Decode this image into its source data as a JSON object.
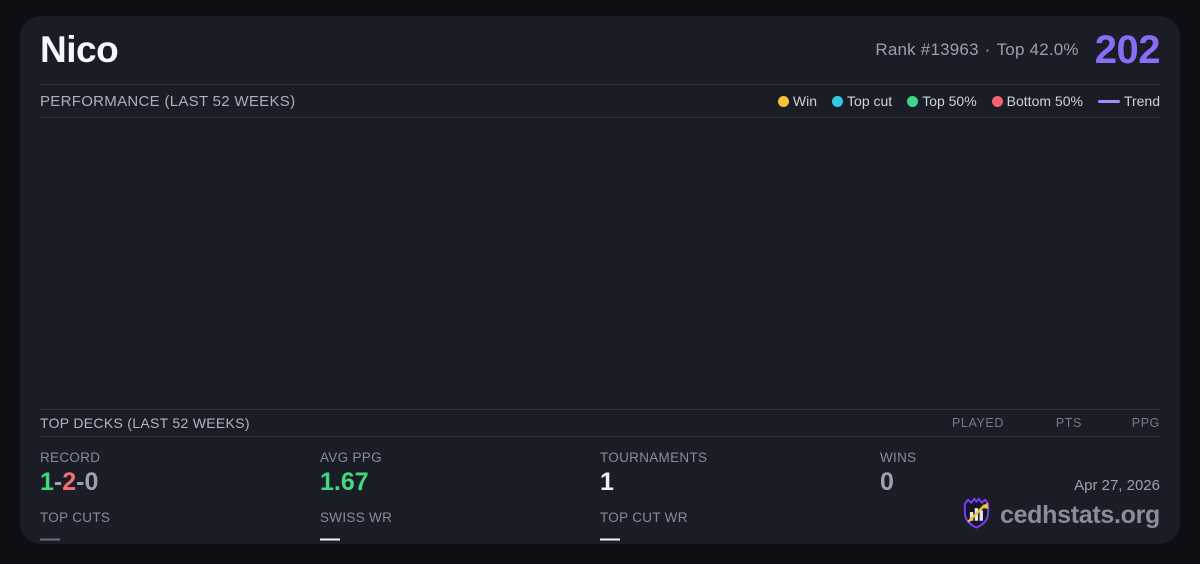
{
  "card": {
    "title": "Nico",
    "rank_text": "Rank #13963",
    "separator": "·",
    "top_percent_text": "Top 42.0%",
    "points": "202",
    "accent_color": "#8b6cf5"
  },
  "performance": {
    "header": "PERFORMANCE (LAST 52 WEEKS)",
    "legend": [
      {
        "label": "Win",
        "color": "#f5c33b",
        "marker": "dot"
      },
      {
        "label": "Top cut",
        "color": "#35c9e3",
        "marker": "dot"
      },
      {
        "label": "Top 50%",
        "color": "#3fd68a",
        "marker": "dot"
      },
      {
        "label": "Bottom 50%",
        "color": "#f4646e",
        "marker": "dot"
      },
      {
        "label": "Trend",
        "color": "#a78bfa",
        "marker": "line"
      }
    ]
  },
  "chart_data": {
    "type": "scatter",
    "title": "PERFORMANCE (LAST 52 WEEKS)",
    "series": [
      {
        "name": "Win",
        "points": []
      },
      {
        "name": "Top cut",
        "points": []
      },
      {
        "name": "Top 50%",
        "points": []
      },
      {
        "name": "Bottom 50%",
        "points": []
      },
      {
        "name": "Trend",
        "points": []
      }
    ],
    "note_visible_points": "chart area is empty in the visible window"
  },
  "top_decks": {
    "header": "TOP DECKS (LAST 52 WEEKS)",
    "columns": [
      "PLAYED",
      "PTS",
      "PPG"
    ],
    "rows": []
  },
  "stats": [
    {
      "label": "RECORD",
      "parts": [
        {
          "text": "1",
          "color": "#42d87e"
        },
        {
          "text": "-",
          "color": "#9aa2af"
        },
        {
          "text": "2",
          "color": "#f46d77"
        },
        {
          "text": "-",
          "color": "#9aa2af"
        },
        {
          "text": "0",
          "color": "#9aa2af"
        }
      ],
      "sub_label": "TOP CUTS",
      "sub_value": "—",
      "sub_value_color": "#657080"
    },
    {
      "label": "AVG PPG",
      "value": "1.67",
      "value_color": "#42d87e",
      "sub_label": "SWISS WR",
      "sub_value": "—",
      "sub_value_color": "#f2f4f8"
    },
    {
      "label": "TOURNAMENTS",
      "value": "1",
      "value_color": "#eef1f5",
      "sub_label": "TOP CUT WR",
      "sub_value": "—",
      "sub_value_color": "#f2f4f8"
    },
    {
      "label": "WINS",
      "value": "0",
      "value_color": "#9aa2af",
      "sub_label": "",
      "sub_value": ""
    }
  ],
  "footer": {
    "date": "Apr 27, 2026",
    "brand": "cedhstats.org",
    "logo_icon": "crown-shield-bar-chart-arrow-logo"
  }
}
